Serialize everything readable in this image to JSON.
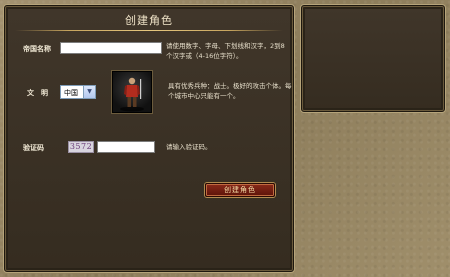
{
  "panel": {
    "title": "创建角色",
    "empire_label": "帝国名称",
    "empire_input_value": "",
    "empire_hint": "请使用数字、字母、下划线和汉字，2到8个汉字或（4-16位字符）。",
    "civ_label": "文　明",
    "civ_selected": "中国",
    "civ_description": "具有优秀兵种：战士。极好的攻击个体。每个城市中心只能有一个。",
    "captcha_label": "验证码",
    "captcha_code": "3572",
    "captcha_input_value": "",
    "captcha_hint": "请输入验证码。",
    "submit_label": "创建角色"
  }
}
